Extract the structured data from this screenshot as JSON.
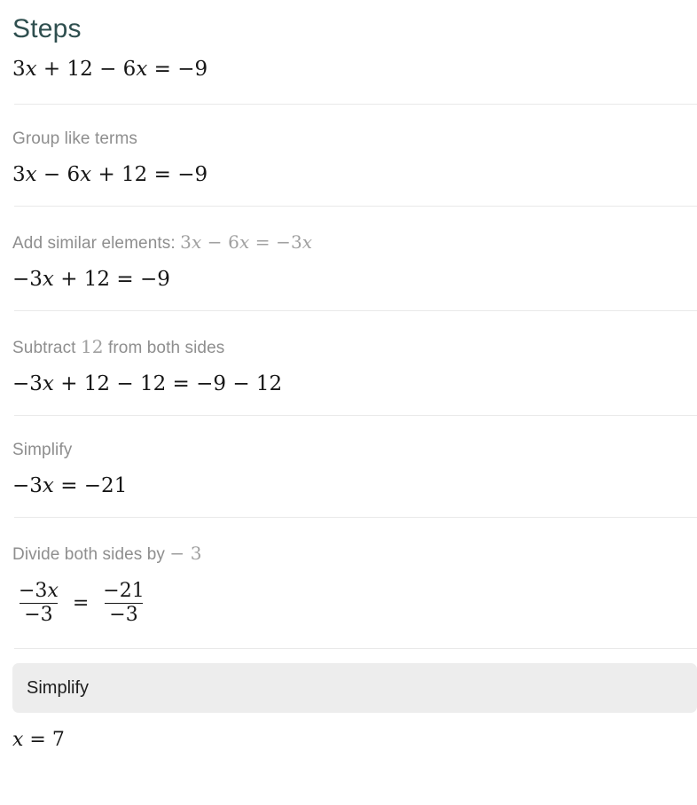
{
  "header": {
    "title": "Steps",
    "title_color": "#2f4f4f"
  },
  "theme": {
    "background": "#ffffff",
    "label_gray": "#8e8e8e",
    "math_black": "#161616",
    "divider": "#e9e9e9",
    "highlight_bg": "#ededed",
    "highlight_text": "#1d1d1d"
  },
  "problem": {
    "equation": "3x + 12 − 6x =  −9"
  },
  "steps": [
    {
      "label": "Group like terms",
      "label_math": "",
      "math": "3x − 6x + 12 =  −9",
      "highlighted": false
    },
    {
      "label": "Add similar elements: ",
      "label_math": "3x − 6x =  −3x",
      "math": "−3x + 12 =  −9",
      "highlighted": false
    },
    {
      "label_pre": "Subtract ",
      "label_math": "12",
      "label_post": " from both sides",
      "math": "−3x + 12 − 12 =  −9 − 12",
      "highlighted": false
    },
    {
      "label": "Simplify",
      "math": "−3x =  −21",
      "highlighted": false
    },
    {
      "label_pre": "Divide both sides by ",
      "label_math": "− 3",
      "math_fraction": {
        "left": {
          "numerator": "−3x",
          "denominator": "−3"
        },
        "operator": "=",
        "right": {
          "numerator": "−21",
          "denominator": "−3"
        }
      },
      "highlighted": false
    },
    {
      "label": "Simplify",
      "math": "x = 7",
      "highlighted": true
    }
  ]
}
